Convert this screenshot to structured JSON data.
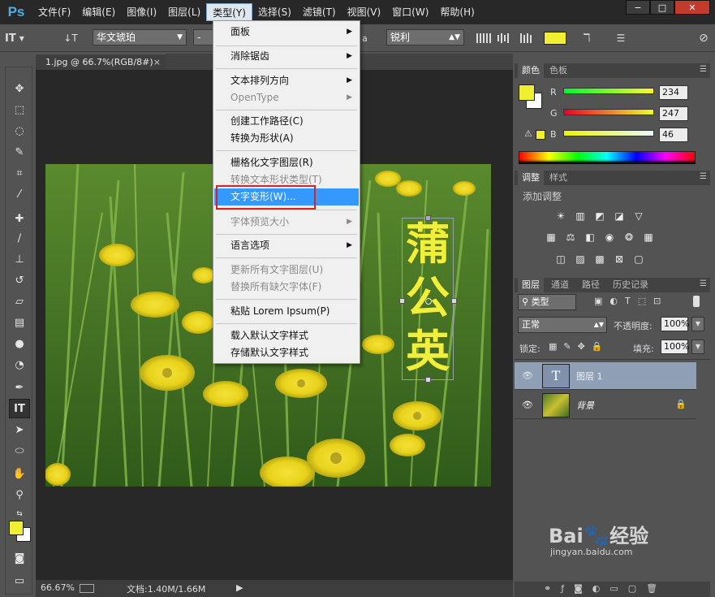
{
  "app": {
    "logo": "Ps"
  },
  "menubar": {
    "items": [
      "文件(F)",
      "编辑(E)",
      "图像(I)",
      "图层(L)",
      "类型(Y)",
      "选择(S)",
      "滤镜(T)",
      "视图(V)",
      "窗口(W)",
      "帮助(H)"
    ],
    "active_index": 4,
    "window_buttons": [
      "−",
      "□",
      "✕"
    ]
  },
  "options": {
    "tool_glyph": "IT",
    "orientation_glyph": "↓T",
    "font_family": "华文琥珀",
    "font_style": "-",
    "aa_prefix": "a",
    "anti_alias": "锐利",
    "color": "#f0f030"
  },
  "document": {
    "tab_title": "1.jpg @ 66.7%(RGB/8#)",
    "tab_close": "×",
    "text_layer": {
      "chars": [
        "蒲",
        "公",
        "英"
      ],
      "color": "#f0f03a"
    }
  },
  "status": {
    "zoom": "66.67%",
    "doc_info": "文档:1.40M/1.66M",
    "arrow": "▶"
  },
  "type_menu": {
    "items": [
      {
        "label": "面板",
        "submenu": true,
        "disabled": false
      },
      {
        "label": "消除锯齿",
        "submenu": true,
        "disabled": false
      },
      {
        "label": "文本排列方向",
        "submenu": true,
        "disabled": false
      },
      {
        "label": "OpenType",
        "submenu": true,
        "disabled": true
      },
      {
        "label": "创建工作路径(C)",
        "submenu": false,
        "disabled": false
      },
      {
        "label": "转换为形状(A)",
        "submenu": false,
        "disabled": false
      },
      {
        "label": "栅格化文字图层(R)",
        "submenu": false,
        "disabled": false
      },
      {
        "label": "转换文本形状类型(T)",
        "submenu": false,
        "disabled": true
      },
      {
        "label": "文字变形(W)...",
        "submenu": false,
        "disabled": false,
        "highlight": true
      },
      {
        "label": "字体预览大小",
        "submenu": true,
        "disabled": true
      },
      {
        "label": "语言选项",
        "submenu": true,
        "disabled": false
      },
      {
        "label": "更新所有文字图层(U)",
        "submenu": false,
        "disabled": true
      },
      {
        "label": "替换所有缺欠字体(F)",
        "submenu": false,
        "disabled": true
      },
      {
        "label": "粘贴 Lorem Ipsum(P)",
        "submenu": false,
        "disabled": false
      },
      {
        "label": "载入默认文字样式",
        "submenu": false,
        "disabled": false
      },
      {
        "label": "存储默认文字样式",
        "submenu": false,
        "disabled": false
      }
    ]
  },
  "color_panel": {
    "tabs": [
      "颜色",
      "色板"
    ],
    "channels": [
      {
        "label": "R",
        "value": "234"
      },
      {
        "label": "G",
        "value": "247"
      },
      {
        "label": "B",
        "value": "46"
      }
    ],
    "warning_glyph": "⚠"
  },
  "adjust_panel": {
    "tabs": [
      "调整",
      "样式"
    ],
    "title": "添加调整"
  },
  "layers_panel": {
    "tabs": [
      "图层",
      "通道",
      "路径",
      "历史记录"
    ],
    "filter_kind": "类型",
    "blend_mode": "正常",
    "opacity_label": "不透明度:",
    "opacity_value": "100%",
    "lock_label": "锁定:",
    "fill_label": "填充:",
    "fill_value": "100%",
    "layers": [
      {
        "name": "图层 1",
        "type": "text",
        "thumb_glyph": "T",
        "selected": true
      },
      {
        "name": "背景",
        "type": "image",
        "locked": true,
        "selected": false
      }
    ]
  },
  "watermark": {
    "brand": "Bai",
    "suffix": "经验",
    "domain": "jingyan.baidu.com"
  }
}
